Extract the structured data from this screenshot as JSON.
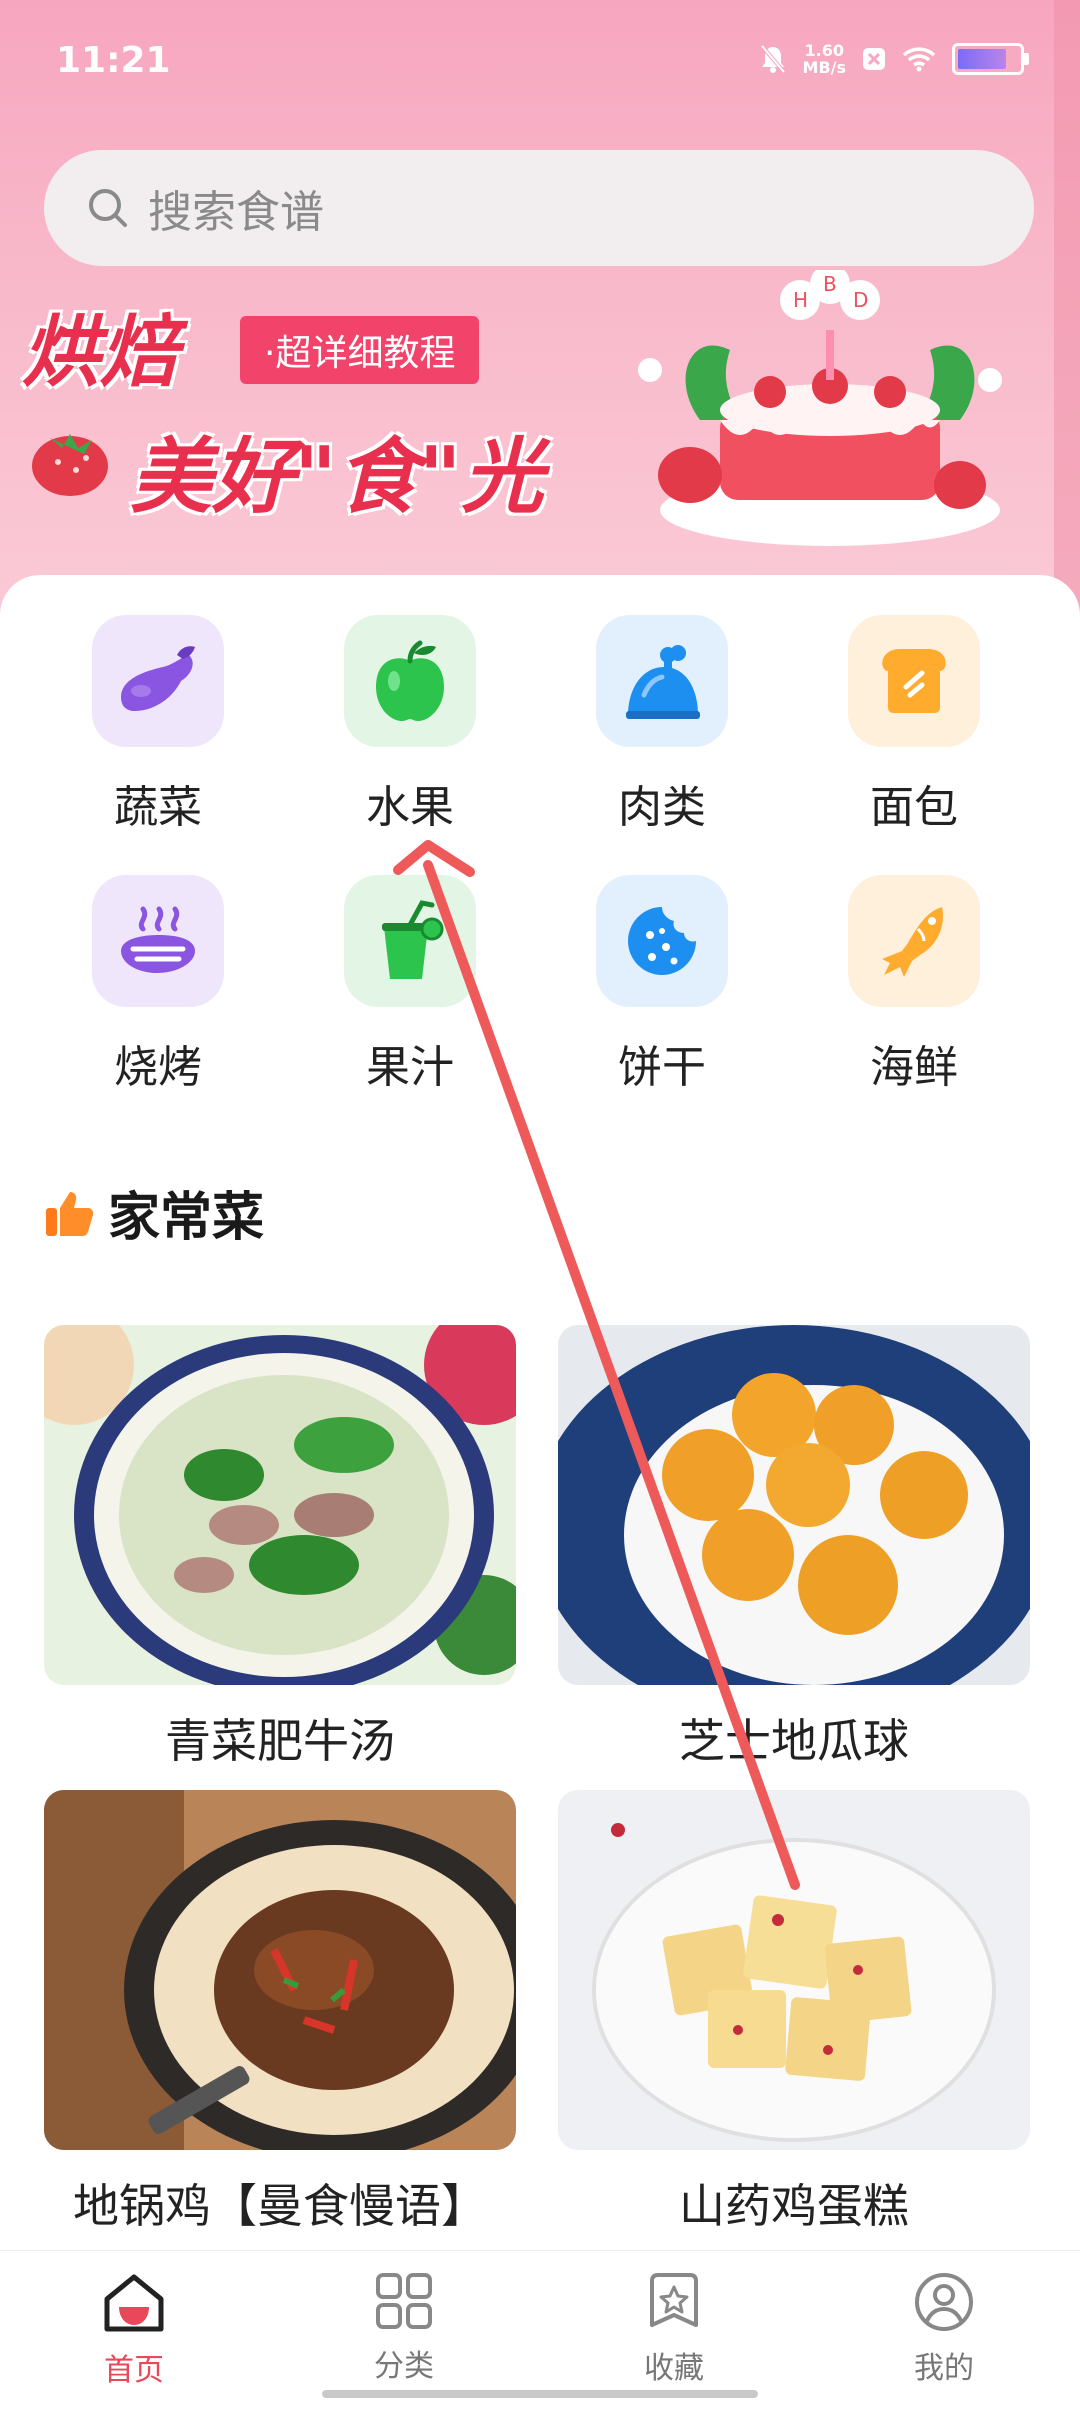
{
  "status": {
    "time": "11:21",
    "speed_value": "1.60",
    "speed_unit": "MB/s"
  },
  "search": {
    "placeholder": "搜索食谱"
  },
  "banner": {
    "title1": "烘焙",
    "tag": "·超详细教程",
    "title2": "美好\"食\"光",
    "cake_letters": [
      "B",
      "H",
      "D"
    ]
  },
  "categories": [
    {
      "label": "蔬菜",
      "icon": "eggplant-icon",
      "bg": "#efe6fb"
    },
    {
      "label": "水果",
      "icon": "apple-icon",
      "bg": "#e3f6e6"
    },
    {
      "label": "肉类",
      "icon": "drumstick-icon",
      "bg": "#e1f0fc"
    },
    {
      "label": "面包",
      "icon": "toast-icon",
      "bg": "#fff0dc"
    },
    {
      "label": "烧烤",
      "icon": "grill-icon",
      "bg": "#efe6fb"
    },
    {
      "label": "果汁",
      "icon": "juice-icon",
      "bg": "#e3f6e6"
    },
    {
      "label": "饼干",
      "icon": "cookie-icon",
      "bg": "#e1f0fc"
    },
    {
      "label": "海鲜",
      "icon": "fish-icon",
      "bg": "#fff0dc"
    }
  ],
  "section": {
    "title": "家常菜",
    "icon": "thumbs-up-icon"
  },
  "recipes": [
    {
      "title": "青菜肥牛汤"
    },
    {
      "title": "芝士地瓜球"
    },
    {
      "title": "地锅鸡【曼食慢语】"
    },
    {
      "title": "山药鸡蛋糕"
    }
  ],
  "tabs": [
    {
      "label": "首页",
      "icon": "home-icon",
      "active": true
    },
    {
      "label": "分类",
      "icon": "grid-icon",
      "active": false
    },
    {
      "label": "收藏",
      "icon": "star-icon",
      "active": false
    },
    {
      "label": "我的",
      "icon": "user-icon",
      "active": false
    }
  ],
  "colors": {
    "accent": "#e8485a",
    "hero_pink": "#f7a6bf",
    "arrow": "#ee5a5a"
  }
}
